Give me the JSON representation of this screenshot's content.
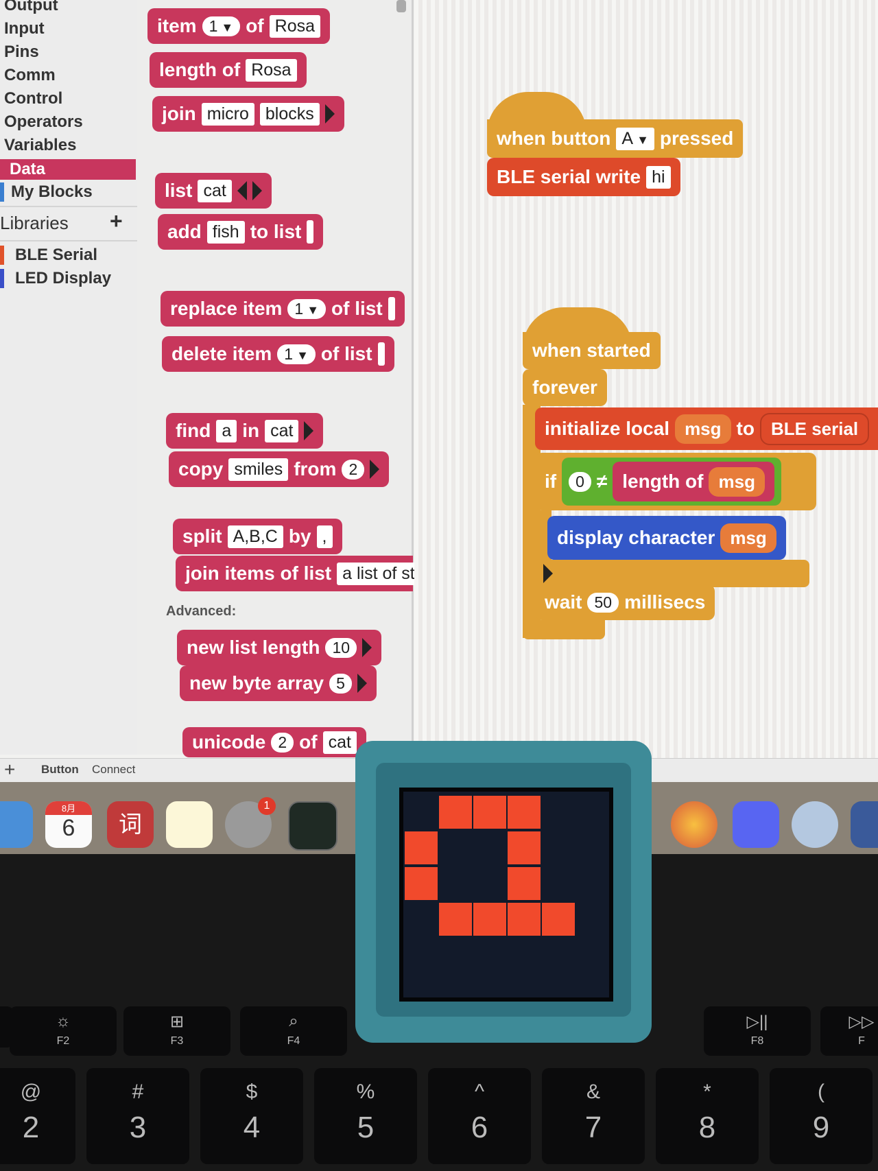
{
  "categories": [
    "Output",
    "Input",
    "Pins",
    "Comm",
    "Control",
    "Operators",
    "Variables",
    "Data",
    "My Blocks"
  ],
  "selected_category": "Data",
  "libraries": {
    "label": "Libraries",
    "add": "+",
    "items": [
      {
        "name": "BLE Serial",
        "color": "#e0522a"
      },
      {
        "name": "LED Display",
        "color": "#3a4fc8"
      }
    ]
  },
  "palette": {
    "item_of": {
      "a": "item",
      "n": "1",
      "b": "of",
      "list": "Rosa"
    },
    "length_of": {
      "a": "length of",
      "v": "Rosa"
    },
    "join": {
      "a": "join",
      "v1": "micro",
      "v2": "blocks"
    },
    "list": {
      "a": "list",
      "v": "cat"
    },
    "add_to": {
      "a": "add",
      "v": "fish",
      "b": "to list"
    },
    "replace_item": {
      "a": "replace item",
      "n": "1",
      "b": "of list"
    },
    "delete_item": {
      "a": "delete item",
      "n": "1",
      "b": "of list"
    },
    "find": {
      "a": "find",
      "v": "a",
      "b": "in",
      "v2": "cat"
    },
    "copy": {
      "a": "copy",
      "v": "smiles",
      "b": "from",
      "n": "2"
    },
    "split": {
      "a": "split",
      "v": "A,B,C",
      "b": "by",
      "v2": ","
    },
    "join_items": {
      "a": "join items of list",
      "v": "a list of stri"
    },
    "advanced": "Advanced:",
    "new_list": {
      "a": "new list length",
      "n": "10"
    },
    "new_byte": {
      "a": "new byte array",
      "n": "5"
    },
    "unicode": {
      "a": "unicode",
      "n": "2",
      "b": "of",
      "v": "cat"
    }
  },
  "script1": {
    "hat_a": "when button",
    "btn": "A",
    "hat_b": "pressed",
    "write": "BLE serial write",
    "val": "hi"
  },
  "script2": {
    "hat": "when started",
    "forever": "forever",
    "init": "initialize local",
    "var": "msg",
    "to": "to",
    "src": "BLE serial",
    "if": "if",
    "zero": "0",
    "neq": "≠",
    "len": "length of",
    "msgvar": "msg",
    "display": "display character",
    "dispvar": "msg",
    "wait": "wait",
    "ms": "50",
    "ms_label": "millisecs"
  },
  "status": {
    "plus": "+",
    "button": "Button",
    "connect": "Connect"
  },
  "dock": {
    "cal_month": "8月",
    "cal_day": "6",
    "dict": "词",
    "badge": "1"
  },
  "keys_f": [
    {
      "icon": "☼",
      "label": "F2"
    },
    {
      "icon": "⊞",
      "label": "F3"
    },
    {
      "icon": "⌕",
      "label": "F4"
    },
    {
      "icon": "▷||",
      "label": "F8"
    },
    {
      "icon": "▷▷",
      "label": "F"
    }
  ],
  "keys_n": [
    {
      "t": "@",
      "b": "2"
    },
    {
      "t": "#",
      "b": "3"
    },
    {
      "t": "$",
      "b": "4"
    },
    {
      "t": "%",
      "b": "5"
    },
    {
      "t": "^",
      "b": "6"
    },
    {
      "t": "&",
      "b": "7"
    },
    {
      "t": "*",
      "b": "8"
    },
    {
      "t": "(",
      "b": "9"
    }
  ],
  "led_pattern": "display character msg"
}
